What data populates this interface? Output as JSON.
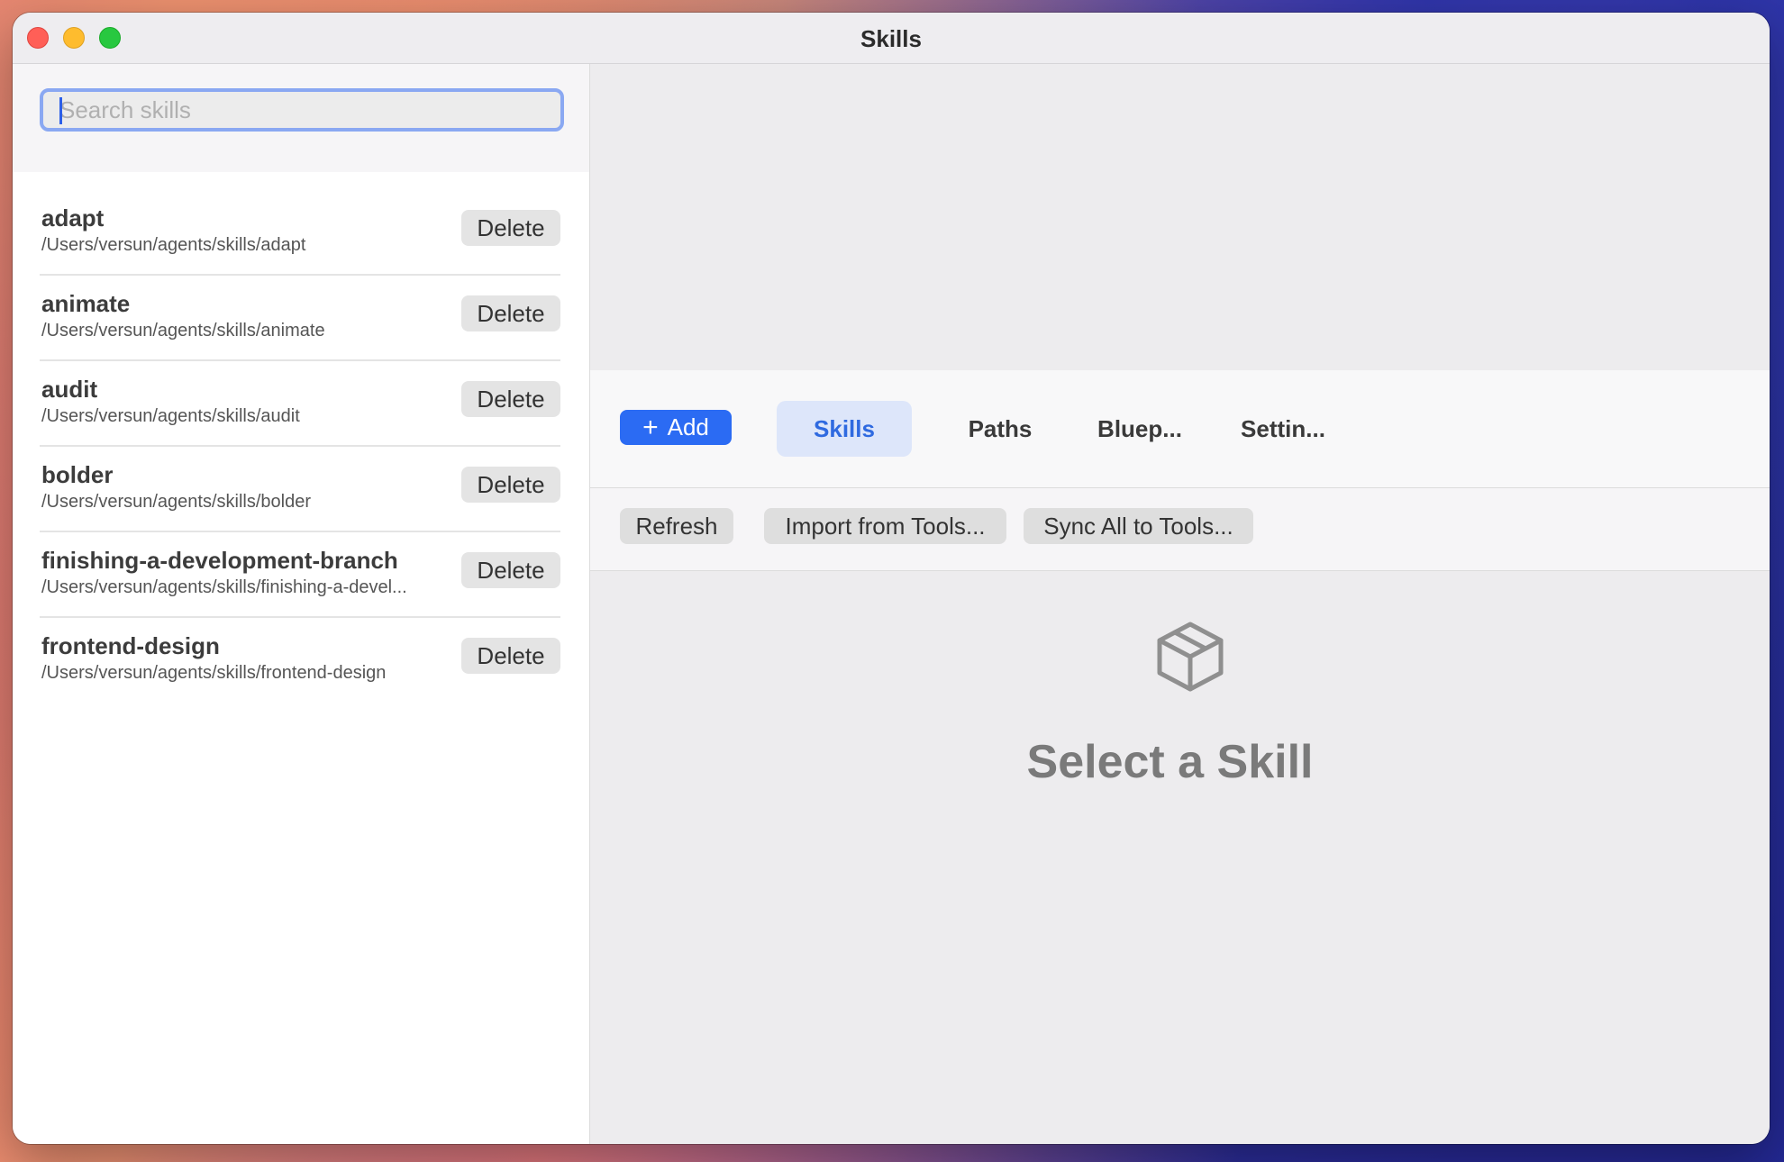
{
  "window": {
    "title": "Skills"
  },
  "search": {
    "placeholder": "Search skills",
    "value": ""
  },
  "skills": [
    {
      "name": "adapt",
      "path": "/Users/versun/agents/skills/adapt",
      "delete_label": "Delete"
    },
    {
      "name": "animate",
      "path": "/Users/versun/agents/skills/animate",
      "delete_label": "Delete"
    },
    {
      "name": "audit",
      "path": "/Users/versun/agents/skills/audit",
      "delete_label": "Delete"
    },
    {
      "name": "bolder",
      "path": "/Users/versun/agents/skills/bolder",
      "delete_label": "Delete"
    },
    {
      "name": "finishing-a-development-branch",
      "path": "/Users/versun/agents/skills/finishing-a-devel...",
      "delete_label": "Delete"
    },
    {
      "name": "frontend-design",
      "path": "/Users/versun/agents/skills/frontend-design",
      "delete_label": "Delete"
    }
  ],
  "toolbar": {
    "add_label": "Add",
    "tabs": [
      {
        "label": "Skills",
        "active": true
      },
      {
        "label": "Paths",
        "active": false
      },
      {
        "label": "Bluep...",
        "active": false
      },
      {
        "label": "Settin...",
        "active": false
      }
    ]
  },
  "actions": {
    "refresh_label": "Refresh",
    "import_label": "Import from Tools...",
    "sync_label": "Sync All to Tools..."
  },
  "empty_state": {
    "icon": "cube-icon",
    "text": "Select a Skill"
  },
  "colors": {
    "accent": "#2b6bf3",
    "tab_active_bg": "#dde6fa",
    "tab_active_text": "#2f6ae0"
  }
}
